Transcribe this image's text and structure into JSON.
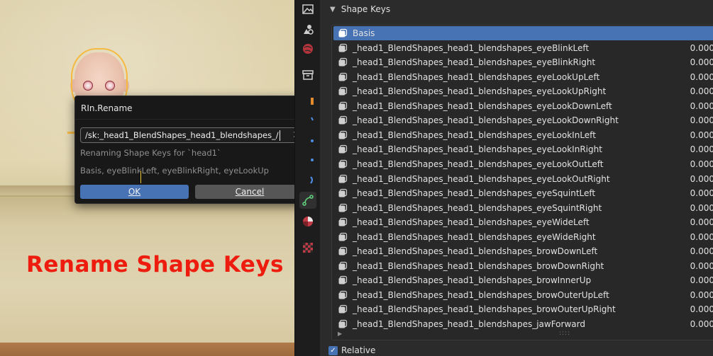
{
  "overlay_title": "Rename Shape Keys",
  "dialog": {
    "title": "RIn.Rename",
    "input_value": "/sk:_head1_BlendShapes_head1_blendshapes_/",
    "info": "Renaming Shape Keys for `head1`",
    "preview": "Basis, eyeBlinkLeft, eyeBlinkRight, eyeLookUp",
    "ok_label": "OK",
    "cancel_label": "Cancel",
    "clear_icon": "x-icon"
  },
  "panel": {
    "section_title": "Shape Keys",
    "relative_label": "Relative",
    "relative_checked": true,
    "grip_label": "::::",
    "expander_icon": "triangle-right-icon",
    "shape_keys": [
      {
        "name": "Basis",
        "value": "",
        "selected": true
      },
      {
        "name": "_head1_BlendShapes_head1_blendshapes_eyeBlinkLeft",
        "value": "0.000"
      },
      {
        "name": "_head1_BlendShapes_head1_blendshapes_eyeBlinkRight",
        "value": "0.000"
      },
      {
        "name": "_head1_BlendShapes_head1_blendshapes_eyeLookUpLeft",
        "value": "0.000"
      },
      {
        "name": "_head1_BlendShapes_head1_blendshapes_eyeLookUpRight",
        "value": "0.000"
      },
      {
        "name": "_head1_BlendShapes_head1_blendshapes_eyeLookDownLeft",
        "value": "0.000"
      },
      {
        "name": "_head1_BlendShapes_head1_blendshapes_eyeLookDownRight",
        "value": "0.000"
      },
      {
        "name": "_head1_BlendShapes_head1_blendshapes_eyeLookInLeft",
        "value": "0.000"
      },
      {
        "name": "_head1_BlendShapes_head1_blendshapes_eyeLookInRight",
        "value": "0.000"
      },
      {
        "name": "_head1_BlendShapes_head1_blendshapes_eyeLookOutLeft",
        "value": "0.000"
      },
      {
        "name": "_head1_BlendShapes_head1_blendshapes_eyeLookOutRight",
        "value": "0.000"
      },
      {
        "name": "_head1_BlendShapes_head1_blendshapes_eyeSquintLeft",
        "value": "0.000"
      },
      {
        "name": "_head1_BlendShapes_head1_blendshapes_eyeSquintRight",
        "value": "0.000"
      },
      {
        "name": "_head1_BlendShapes_head1_blendshapes_eyeWideLeft",
        "value": "0.000"
      },
      {
        "name": "_head1_BlendShapes_head1_blendshapes_eyeWideRight",
        "value": "0.000"
      },
      {
        "name": "_head1_BlendShapes_head1_blendshapes_browDownLeft",
        "value": "0.000"
      },
      {
        "name": "_head1_BlendShapes_head1_blendshapes_browDownRight",
        "value": "0.000"
      },
      {
        "name": "_head1_BlendShapes_head1_blendshapes_browInnerUp",
        "value": "0.000"
      },
      {
        "name": "_head1_BlendShapes_head1_blendshapes_browOuterUpLeft",
        "value": "0.000"
      },
      {
        "name": "_head1_BlendShapes_head1_blendshapes_browOuterUpRight",
        "value": "0.000"
      },
      {
        "name": "_head1_BlendShapes_head1_blendshapes_jawForward",
        "value": "0.000"
      }
    ]
  },
  "tabs": [
    {
      "icon": "image-icon"
    },
    {
      "icon": "scene-icon"
    },
    {
      "icon": "world-icon"
    },
    {
      "icon": "collection-icon"
    },
    {
      "icon": "object-icon"
    },
    {
      "icon": "modifier-icon"
    },
    {
      "icon": "particles-icon"
    },
    {
      "icon": "physics-icon"
    },
    {
      "icon": "constraints-icon"
    },
    {
      "icon": "object-data-icon",
      "active": true
    },
    {
      "icon": "material-icon"
    },
    {
      "icon": "texture-icon"
    }
  ],
  "colors": {
    "accent": "#4772b3",
    "overlay_title": "#ee1c0e",
    "selection_outline": "#f6b940"
  }
}
